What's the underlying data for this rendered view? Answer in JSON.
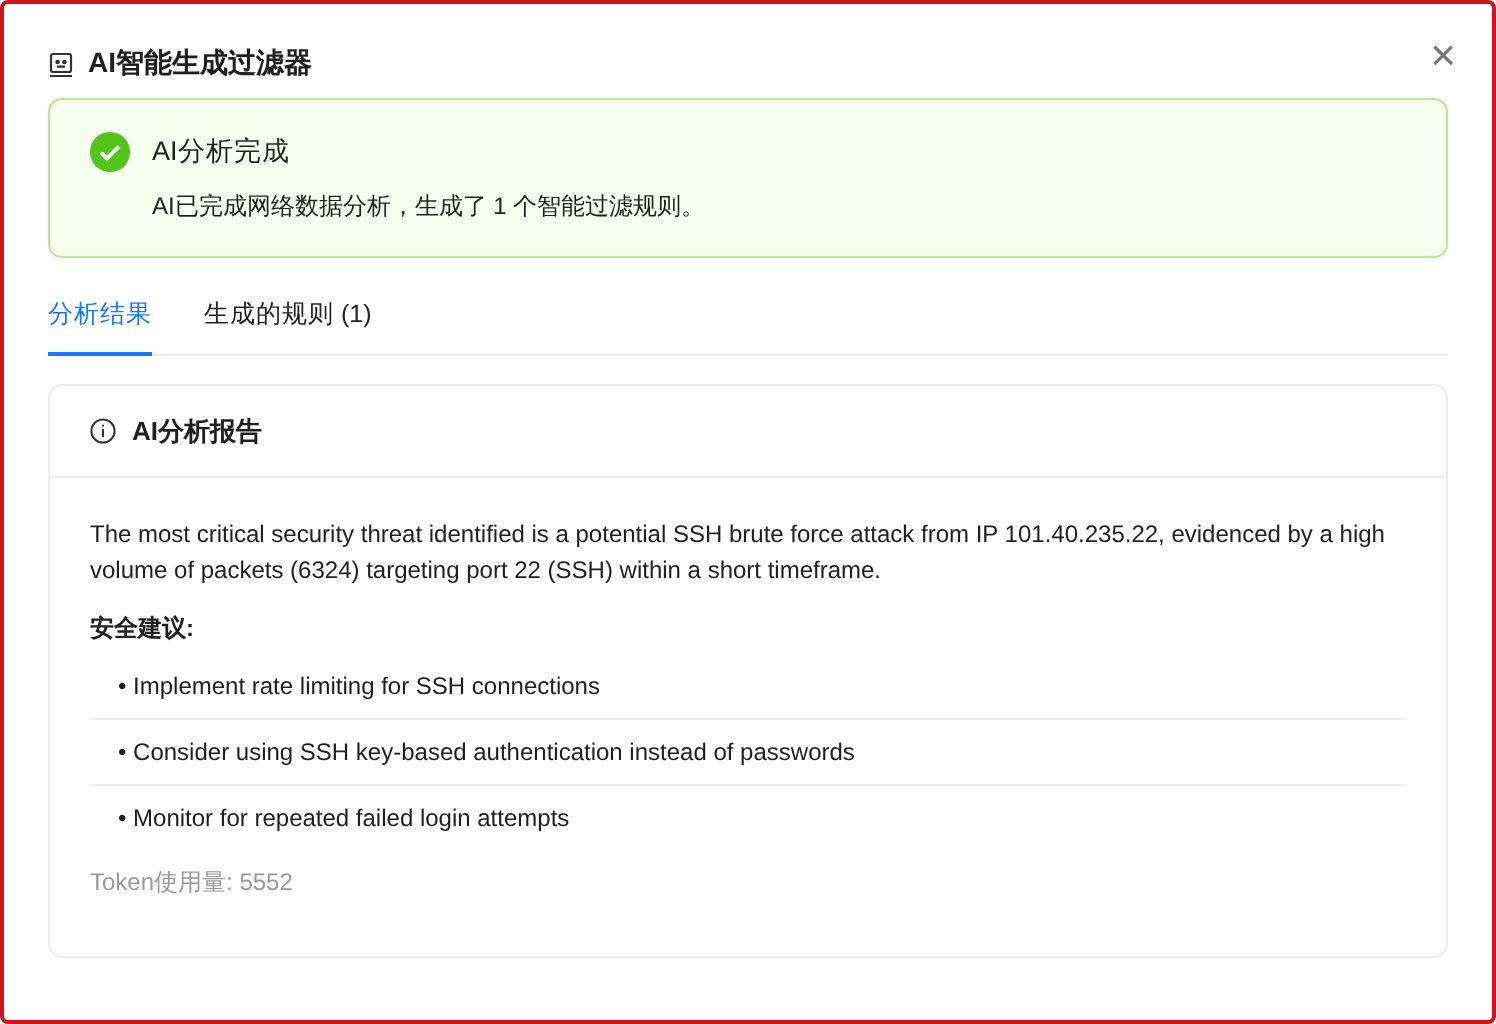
{
  "dialog": {
    "title": "AI智能生成过滤器",
    "close": "×"
  },
  "alert": {
    "title": "AI分析完成",
    "message": "AI已完成网络数据分析，生成了 1 个智能过滤规则。"
  },
  "tabs": [
    {
      "label": "分析结果",
      "selected": true
    },
    {
      "label": "生成的规则 (1)",
      "selected": false
    }
  ],
  "report": {
    "title": "AI分析报告",
    "summary": "The most critical security threat identified is a potential SSH brute force attack from IP 101.40.235.22, evidenced by a high volume of packets (6324) targeting port 22 (SSH) within a short timeframe.",
    "advice_heading": "安全建议:",
    "advice": [
      "• Implement rate limiting for SSH connections",
      "• Consider using SSH key-based authentication instead of passwords",
      "• Monitor for repeated failed login attempts"
    ],
    "token_usage": "Token使用量: 5552"
  }
}
